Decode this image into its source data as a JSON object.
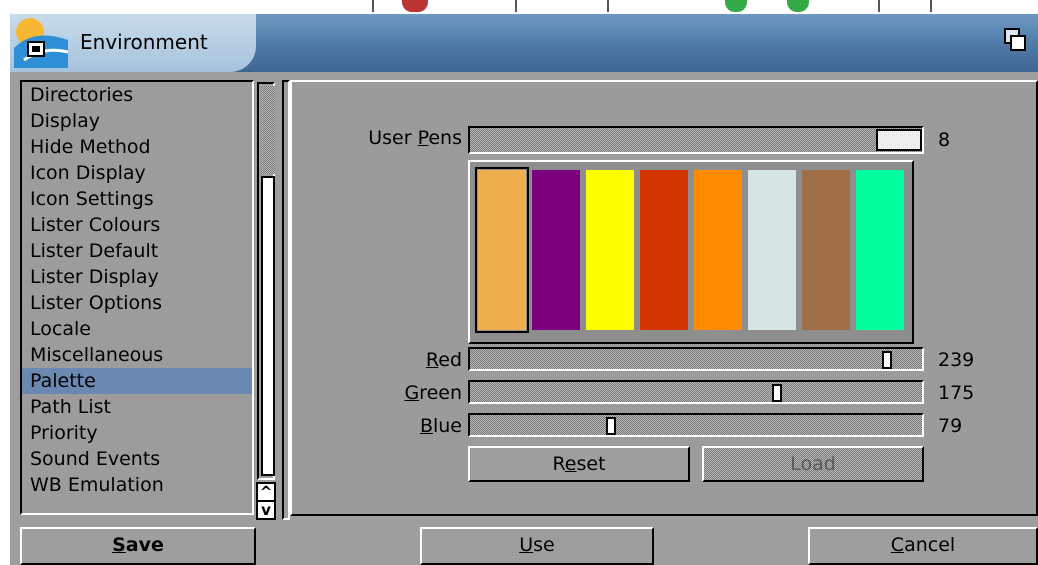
{
  "window": {
    "title": "Environment",
    "icons": {
      "logo": "workbench-logo-icon",
      "depth": "depth-gadget-icon"
    }
  },
  "settings_list": {
    "items": [
      {
        "label": "Directories"
      },
      {
        "label": "Display"
      },
      {
        "label": "Hide Method"
      },
      {
        "label": "Icon Display"
      },
      {
        "label": "Icon Settings"
      },
      {
        "label": "Lister Colours"
      },
      {
        "label": "Lister Default"
      },
      {
        "label": "Lister Display"
      },
      {
        "label": "Lister Options"
      },
      {
        "label": "Locale"
      },
      {
        "label": "Miscellaneous"
      },
      {
        "label": "Palette"
      },
      {
        "label": "Path List"
      },
      {
        "label": "Priority"
      },
      {
        "label": "Sound Events"
      },
      {
        "label": "WB Emulation"
      }
    ],
    "selected": "Palette",
    "scroll_up_glyph": "^",
    "scroll_down_glyph": "v"
  },
  "palette": {
    "user_pens": {
      "label_pre": "User ",
      "label_key": "P",
      "label_post": "ens",
      "value": "8",
      "level": 1.0
    },
    "pens": [
      {
        "color": "#efaf4f",
        "selected": true
      },
      {
        "color": "#7a007e"
      },
      {
        "color": "#ffff00"
      },
      {
        "color": "#d23500"
      },
      {
        "color": "#ff8c00"
      },
      {
        "color": "#d6e4e4"
      },
      {
        "color": "#a06e46"
      },
      {
        "color": "#00ff9e"
      }
    ],
    "red": {
      "label_key": "R",
      "label_post": "ed",
      "value": "239",
      "level": 0.937
    },
    "green": {
      "label_key": "G",
      "label_post": "reen",
      "value": "175",
      "level": 0.686
    },
    "blue": {
      "label_key": "B",
      "label_post": "lue",
      "value": "79",
      "level": 0.31
    },
    "reset_label_pre": "R",
    "reset_label_key": "e",
    "reset_label_post": "set",
    "load_label": "Load"
  },
  "buttons": {
    "save_key": "S",
    "save_post": "ave",
    "use_key": "U",
    "use_post": "se",
    "cancel_key": "C",
    "cancel_post": "ancel"
  },
  "colors": {
    "selection": "#6a88b2",
    "window_bg": "#9e9e9e",
    "titlebar": "#4f7aa8"
  }
}
